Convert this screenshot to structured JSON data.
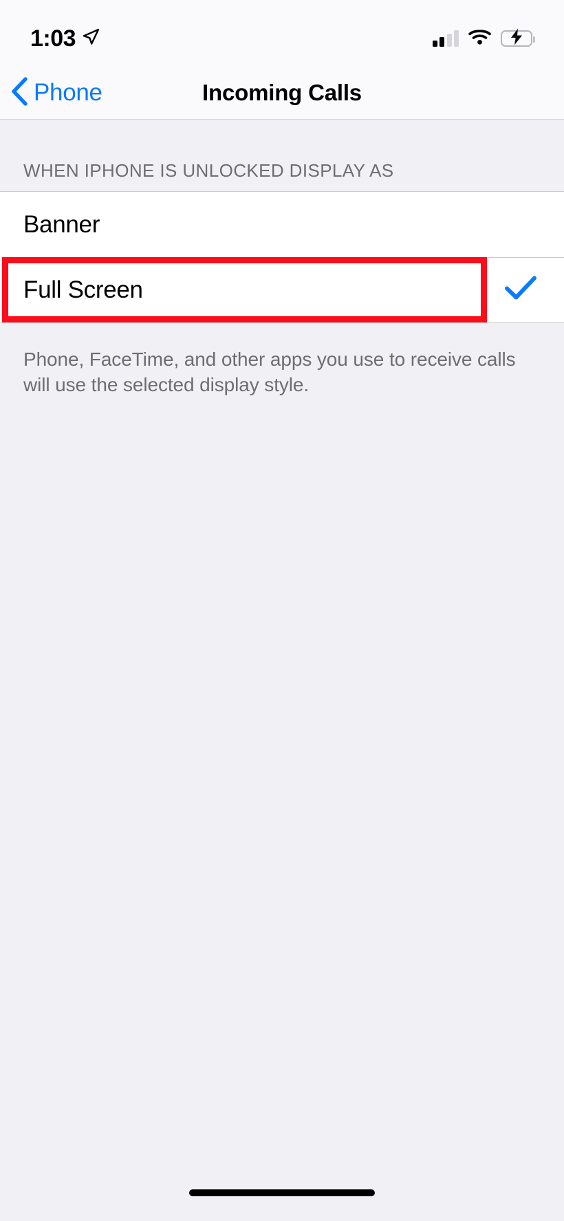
{
  "status_bar": {
    "time": "1:03",
    "location_icon": "location-arrow-icon",
    "cellular_icon": "cellular-signal-icon",
    "cellular_bars_filled": 2,
    "cellular_bars_total": 4,
    "wifi_icon": "wifi-icon",
    "battery_icon": "battery-charging-icon",
    "battery_charging": true,
    "battery_color": "#3ad351"
  },
  "nav_bar": {
    "back_label": "Phone",
    "back_icon": "chevron-left-icon",
    "title": "Incoming Calls",
    "accent_color": "#0b7bfb"
  },
  "section": {
    "header": "WHEN IPHONE IS UNLOCKED DISPLAY AS",
    "options": [
      {
        "label": "Banner",
        "selected": false
      },
      {
        "label": "Full Screen",
        "selected": true
      }
    ],
    "checkmark_icon": "checkmark-icon",
    "checkmark_color": "#0b7bfb"
  },
  "footer": {
    "note": "Phone, FaceTime, and other apps you use to receive calls will use the selected display style."
  },
  "annotation": {
    "type": "highlight-rectangle",
    "color": "#fc0d1c",
    "target": "Full Screen"
  },
  "home_indicator": {
    "label": "home-indicator"
  }
}
